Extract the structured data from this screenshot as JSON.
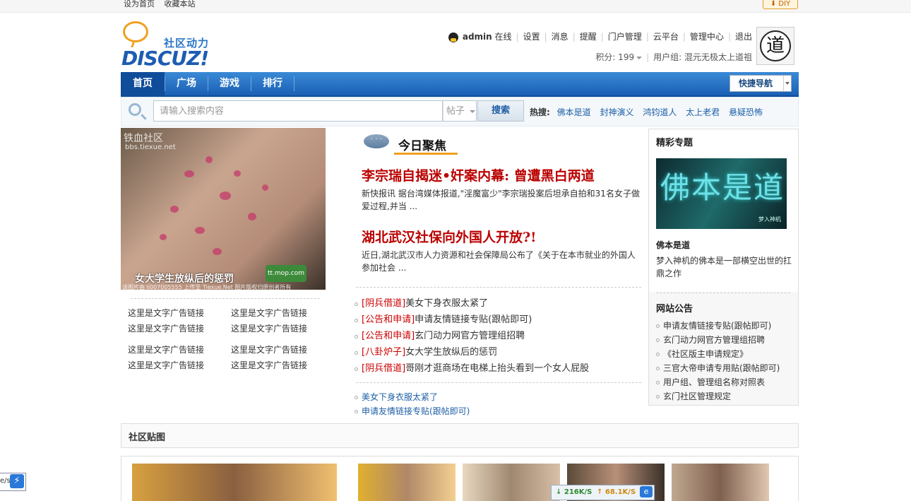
{
  "topbar": {
    "set_home": "设为首页",
    "bookmark": "收藏本站",
    "diy": "DIY"
  },
  "logo": {
    "slogan": "社区动力",
    "brand": "DISCUZ!"
  },
  "user": {
    "name": "admin",
    "status": "在线",
    "links": [
      "设置",
      "消息",
      "提醒",
      "门户管理",
      "云平台",
      "管理中心",
      "退出"
    ],
    "points_label": "积分: 199",
    "group_label": "用户组: 混元无极太上道祖",
    "avatar_char": "道"
  },
  "nav": {
    "items": [
      "首页",
      "广场",
      "游戏",
      "排行"
    ],
    "quick": "快捷导航"
  },
  "search": {
    "placeholder": "请输入搜索内容",
    "type": "帖子",
    "button": "搜索",
    "hot_label": "热搜:",
    "hot": [
      "佛本是道",
      "封神演义",
      "鸿钧道人",
      "太上老君",
      "悬疑恐怖"
    ]
  },
  "slide": {
    "watermark": "铁血社区",
    "watermark_url": "bbs.tiexue.net",
    "caption": "女大学生放纵后的惩罚",
    "badge": "tt.mop.com",
    "footer": "该图片由 li007005555 上传至 Tiexue.Net 图片版权归原创者所有"
  },
  "ads": [
    "这里是文字广告链接",
    "这里是文字广告链接",
    "这里是文字广告链接",
    "这里是文字广告链接",
    "这里是文字广告链接",
    "这里是文字广告链接",
    "这里是文字广告链接",
    "这里是文字广告链接"
  ],
  "focus": {
    "title": "今日聚焦",
    "headlines": [
      {
        "title": "李宗瑞自揭迷•奸案内幕: 曾遭黑白两道",
        "summary": "新快报讯 据台湾媒体报道,\"淫魔富少\"李宗瑞投案后坦承自拍和31名女子做爱过程,并当 ..."
      },
      {
        "title": "湖北武汉社保向外国人开放?!",
        "summary": "近日,湖北武汉市人力资源和社会保障局公布了《关于在本市就业的外国人参加社会 ..."
      }
    ],
    "list": [
      {
        "cat": "[阴兵借道]",
        "text": "美女下身衣服太紧了"
      },
      {
        "cat": "[公告和申请]",
        "text": "申请友情链接专贴(跟帖即可)"
      },
      {
        "cat": "[公告和申请]",
        "text": "玄门动力网官方管理组招聘"
      },
      {
        "cat": "[八卦炉子]",
        "text": "女大学生放纵后的惩罚"
      },
      {
        "cat": "[阴兵借道]",
        "text": "哥刚才逛商场在电梯上抬头看到一个女人屁股"
      }
    ],
    "list2": [
      "美女下身衣服太紧了",
      "申请友情链接专贴(跟帖即可)"
    ]
  },
  "sidebar": {
    "topics_title": "精彩专题",
    "topic_image_text": "佛本是道",
    "topic_image_sub": "梦入神机",
    "topic_name": "佛本是道",
    "topic_desc": "梦入神机的佛本是一部横空出世的扛鼎之作",
    "notice_title": "网站公告",
    "notices": [
      "申请友情链接专贴(跟帖即可)",
      "玄门动力网官方管理组招聘",
      "《社区版主申请规定》",
      "三官大帝申请专用贴(跟帖即可)",
      "用户组、管理组名称对照表",
      "玄门社区管理规定"
    ]
  },
  "gallery": {
    "title": "社区贴图"
  },
  "widgets": {
    "float_label": "e/s",
    "speed_down": "216K/S",
    "speed_up": "68.1K/S"
  },
  "colors": {
    "nav_blue": "#1a5fb4",
    "headline_red": "#b00000",
    "link_blue": "#1c5ea6",
    "accent_orange": "#f0a020"
  }
}
